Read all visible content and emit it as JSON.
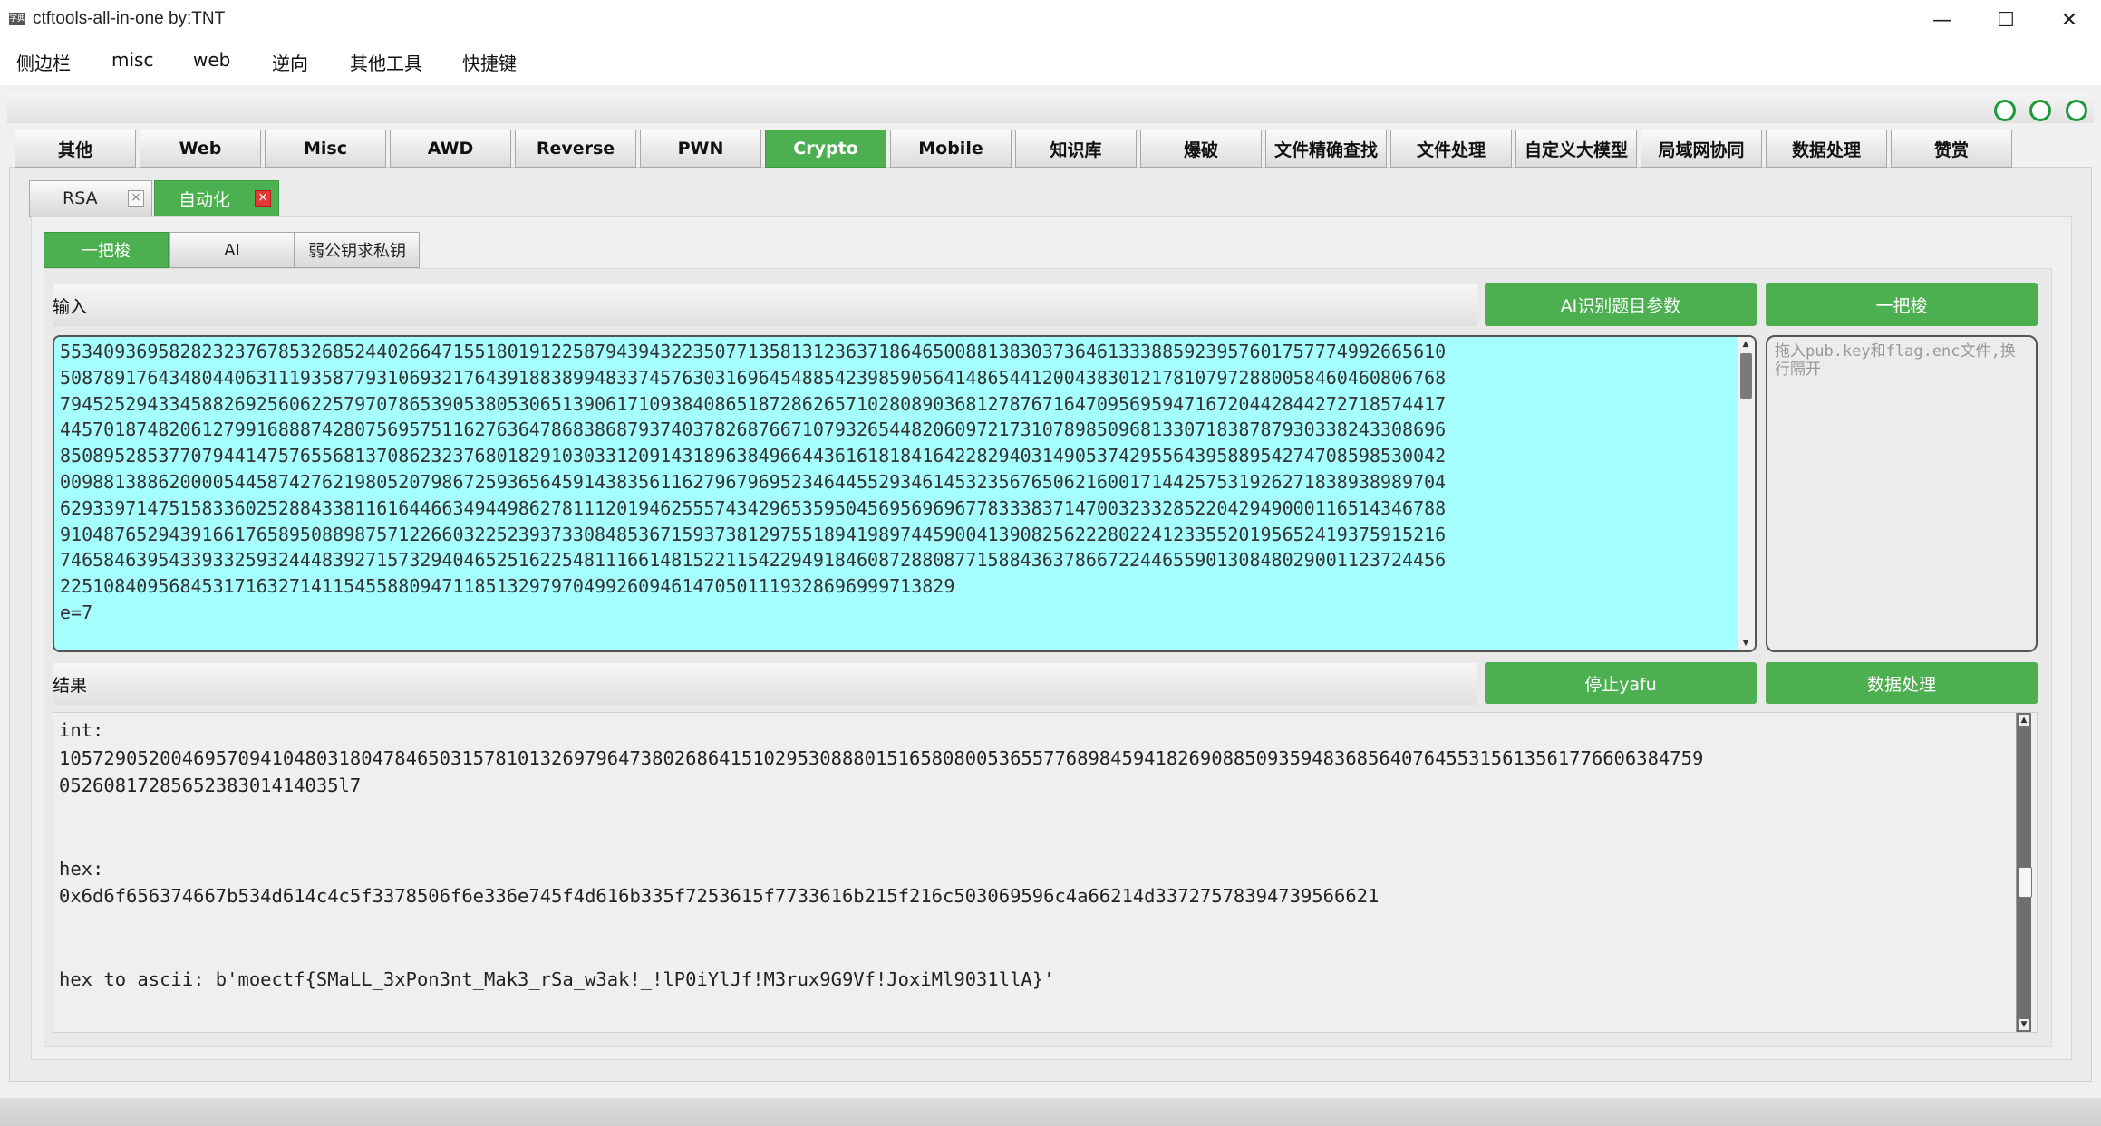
{
  "window": {
    "app_icon": "字典",
    "title": "ctftools-all-in-one   by:TNT",
    "min_icon": "—",
    "max_icon": "☐",
    "close_icon": "✕"
  },
  "menu": [
    "侧边栏",
    "misc",
    "web",
    "逆向",
    "其他工具",
    "快捷键"
  ],
  "main_tabs": [
    "其他",
    "Web",
    "Misc",
    "AWD",
    "Reverse",
    "PWN",
    "Crypto",
    "Mobile",
    "知识库",
    "爆破",
    "文件精确查找",
    "文件处理",
    "自定义大模型",
    "局域网协同",
    "数据处理",
    "赞赏"
  ],
  "active_main_tab": "Crypto",
  "sub_tabs": [
    {
      "label": "RSA",
      "close": "×"
    },
    {
      "label": "自动化",
      "close": "×"
    }
  ],
  "mode_tabs": [
    "一把梭",
    "AI",
    "弱公钥求私钥"
  ],
  "input_section": {
    "label": "输入",
    "btn_ai": "AI识别题目参数",
    "btn_run": "一把梭",
    "lines": [
      "5534093695828232376785326852440266471551801912258794394322350771358131236371864650088138303736461333885923957601757774992665610",
      "5087891764348044063111935877931069321764391883899483374576303169645488542398590564148654412004383012178107972880058460460806768",
      "7945252943345882692560622579707865390538053065139061710938408651872862657102808903681278767164709569594716720442844272718574417",
      "4457018748206127991688874280756957511627636478683868793740378268766710793265448206097217310789850968133071838787930338243308696",
      "8508952853770794414757655681370862323768018291030331209143189638496644361618184164228294031490537429556439588954274708598530042",
      "0098813886200005445874276219805207986725936564591438356116279679695234644552934614532356765062160017144257531926271838938989704",
      "6293397147515833602528843381161644663494498627811120194625557434296535950456956969677833383714700323328522042949000116514346788",
      "9104876529439166176589508898757122660322523937330848536715937381297551894198974459004139082562228022412335520195652419375915216",
      "7465846395433933259324448392715732940465251622548111661481522115422949184608728808771588436378667224465590130848029001123724456",
      "2251084095684531716327141154558809471185132979704992609461470501119328696999713829",
      "e=7"
    ],
    "side_placeholder": "拖入pub.key和flag.enc文件,换行隔开",
    "scroll_up": "▲",
    "scroll_down": "▼"
  },
  "result_section": {
    "label": "结果",
    "btn_stop": "停止yafu",
    "btn_data": "数据处理",
    "lines": [
      "int:",
      "105729052004695709410480318047846503157810132697964738026864151029530888015165808005365577689845941826908850935948368564076455315613561776606384759",
      "0526081728565238301414035l7",
      "",
      "",
      "hex:",
      "0x6d6f656374667b534d614c4c5f3378506f6e336e745f4d616b335f7253615f7733616b215f216c503069596c4a66214d33727578394739566621",
      "",
      "",
      "hex to ascii: b'moectf{SMaLL_3xPon3nt_Mak3_rSa_w3ak!_!lP0iYlJf!M3rux9G9Vf!JoxiMl9031llA}'"
    ]
  },
  "colors": {
    "accent": "#4caf50",
    "input_bg": "#a6ffff"
  }
}
